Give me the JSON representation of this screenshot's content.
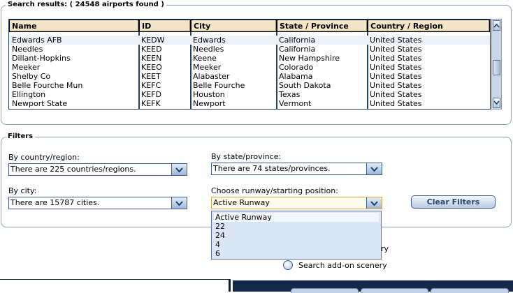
{
  "results": {
    "title": "Search results: ( 24548 airports found )",
    "columns": [
      "Name",
      "ID",
      "City",
      "State / Province",
      "Country / Region"
    ],
    "rows": [
      [
        "Edwards AFB",
        "KEDW",
        "Edwards",
        "California",
        "United States"
      ],
      [
        "Needles",
        "KEED",
        "Needles",
        "California",
        "United States"
      ],
      [
        "Dillant-Hopkins",
        "KEEN",
        "Keene",
        "New Hampshire",
        "United States"
      ],
      [
        "Meeker",
        "KEEO",
        "Meeker",
        "Colorado",
        "United States"
      ],
      [
        "Shelby Co",
        "KEET",
        "Alabaster",
        "Alabama",
        "United States"
      ],
      [
        "Belle Fourche Mun",
        "KEFC",
        "Belle Fourche",
        "South Dakota",
        "United States"
      ],
      [
        "Ellington",
        "KEFD",
        "Houston",
        "Texas",
        "United States"
      ],
      [
        "Newport State",
        "KEFK",
        "Newport",
        "Vermont",
        "United States"
      ]
    ]
  },
  "filters": {
    "title": "Filters",
    "country_label": "By country/region:",
    "country_value": "There are 225 countries/regions.",
    "state_label": "By state/province:",
    "state_value": "There are 74 states/provinces.",
    "city_label": "By city:",
    "city_value": "There are 15787 cities.",
    "runway_label": "Choose runway/starting position:",
    "runway_value": "Active Runway",
    "runway_options": [
      "Active Runway",
      "22",
      "24",
      "4",
      "6"
    ],
    "clear_button": "Clear Filters"
  },
  "options": {
    "radio1_label_partial": "ry",
    "radio2_label": "Search add-on scenery"
  },
  "colors": {
    "header_bg": "#f3e6c8",
    "frame_blue": "#8aa1c1",
    "dark_navy": "#14284a"
  }
}
